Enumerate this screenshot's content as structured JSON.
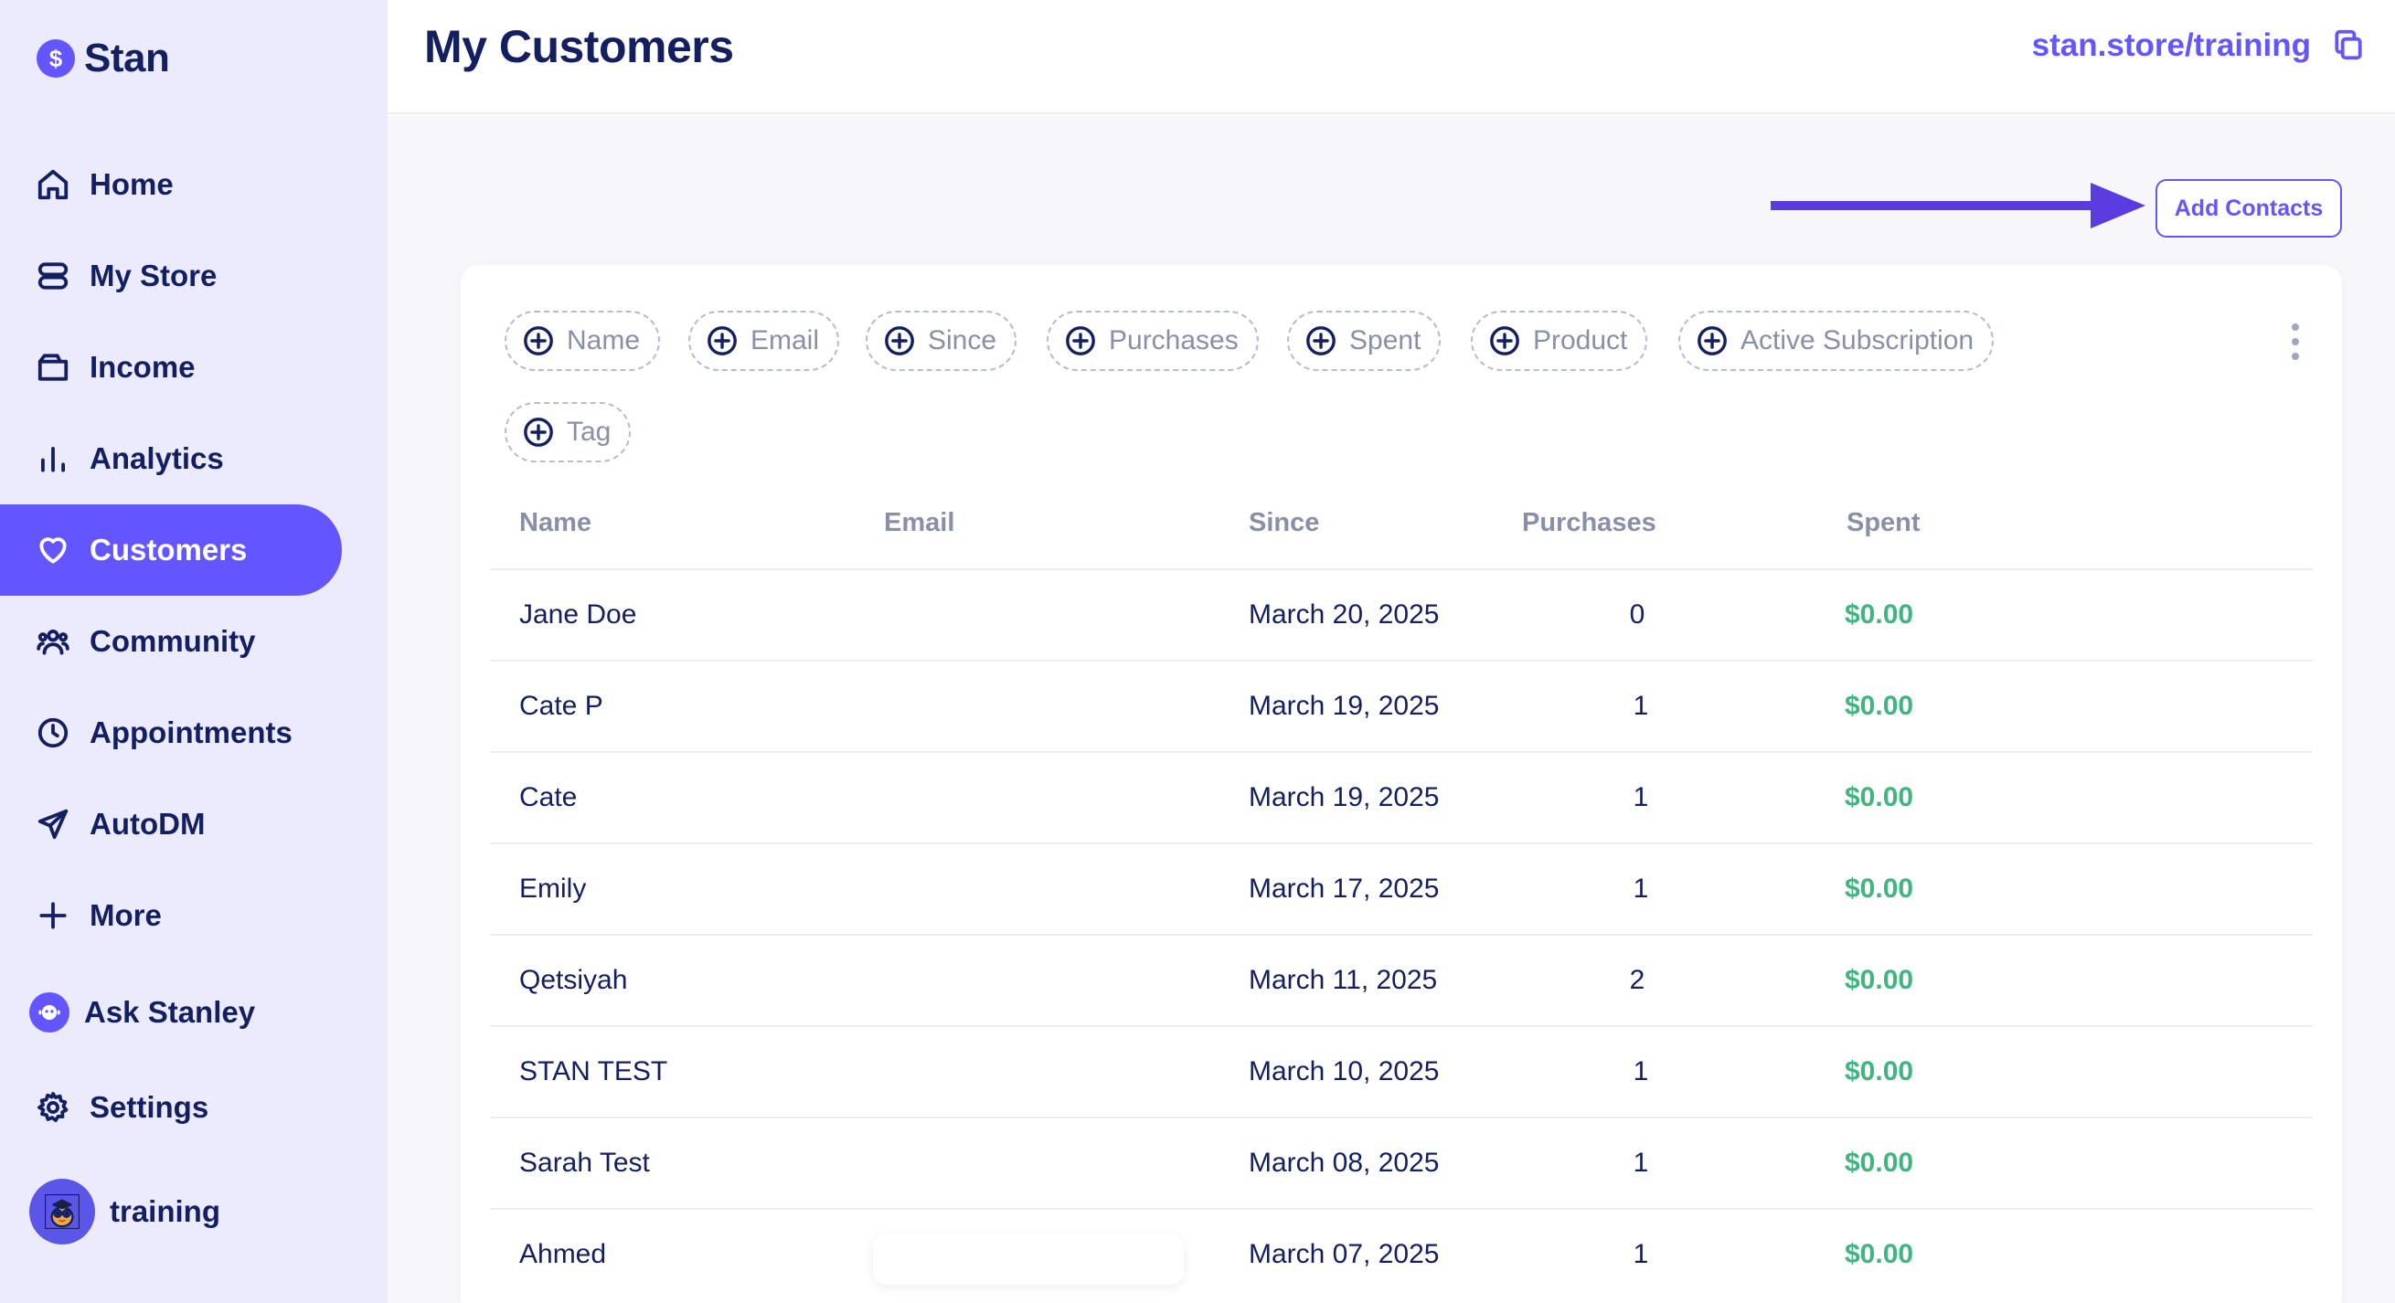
{
  "brand": {
    "name": "Stan",
    "logo_glyph": "$"
  },
  "sidebar": {
    "items": [
      {
        "label": "Home",
        "icon": "home-icon"
      },
      {
        "label": "My Store",
        "icon": "store-icon"
      },
      {
        "label": "Income",
        "icon": "wallet-icon"
      },
      {
        "label": "Analytics",
        "icon": "bar-chart-icon"
      },
      {
        "label": "Customers",
        "icon": "heart-icon",
        "active": true
      },
      {
        "label": "Community",
        "icon": "users-icon"
      },
      {
        "label": "Appointments",
        "icon": "clock-icon"
      },
      {
        "label": "AutoDM",
        "icon": "send-icon"
      },
      {
        "label": "More",
        "icon": "plus-icon"
      },
      {
        "label": "Ask Stanley",
        "icon": "stanley-bot-icon"
      },
      {
        "label": "Settings",
        "icon": "gear-icon"
      },
      {
        "label": "training",
        "icon": "avatar"
      }
    ]
  },
  "header": {
    "title": "My Customers",
    "store_link": "stan.store/training"
  },
  "toolbar": {
    "add_contacts_label": "Add Contacts"
  },
  "filters": [
    "Name",
    "Email",
    "Since",
    "Purchases",
    "Spent",
    "Product",
    "Active Subscription",
    "Tag"
  ],
  "table": {
    "columns": [
      "Name",
      "Email",
      "Since",
      "Purchases",
      "Spent"
    ],
    "rows": [
      {
        "name": "Jane Doe",
        "email": "",
        "since": "March 20, 2025",
        "purchases": "0",
        "spent": "$0.00"
      },
      {
        "name": "Cate P",
        "email": "",
        "since": "March 19, 2025",
        "purchases": "1",
        "spent": "$0.00"
      },
      {
        "name": "Cate",
        "email": "",
        "since": "March 19, 2025",
        "purchases": "1",
        "spent": "$0.00"
      },
      {
        "name": "Emily",
        "email": "",
        "since": "March 17, 2025",
        "purchases": "1",
        "spent": "$0.00"
      },
      {
        "name": "Qetsiyah",
        "email": "",
        "since": "March 11, 2025",
        "purchases": "2",
        "spent": "$0.00"
      },
      {
        "name": "STAN TEST",
        "email": "",
        "since": "March 10, 2025",
        "purchases": "1",
        "spent": "$0.00"
      },
      {
        "name": "Sarah Test",
        "email": "",
        "since": "March 08, 2025",
        "purchases": "1",
        "spent": "$0.00"
      },
      {
        "name": "Ahmed",
        "email": "",
        "since": "March 07, 2025",
        "purchases": "1",
        "spent": "$0.00"
      }
    ]
  },
  "colors": {
    "accent": "#6355ff",
    "navy": "#131f60",
    "money": "#3fb580",
    "sidebar_bg": "#ebebfd"
  }
}
